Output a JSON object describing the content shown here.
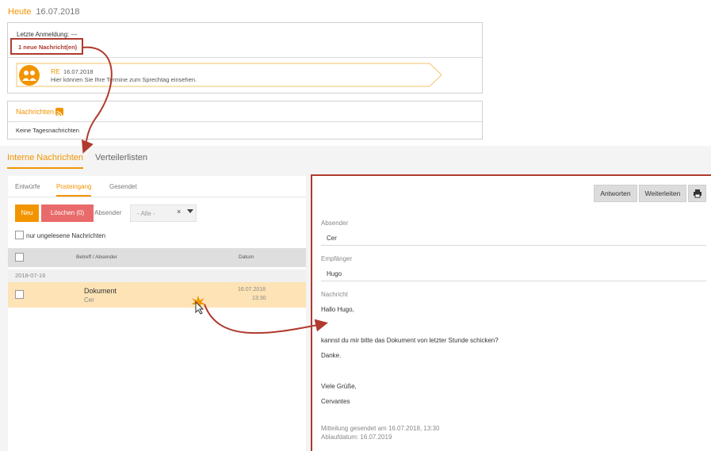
{
  "today": {
    "label": "Heute",
    "date": "16.07.2018"
  },
  "login": {
    "last_login": "Letzte Anmeldung: ---",
    "new_messages": "1 neue Nachricht(en)"
  },
  "appointment": {
    "code": "RE",
    "date": "16.07.2018",
    "text": "Hier können Sie Ihre Termine zum Sprechtag einsehen.",
    "icon": "people-icon"
  },
  "news": {
    "title": "Nachrichten",
    "icon": "rss-icon",
    "empty": "Keine Tagesnachrichten"
  },
  "main_tabs": [
    {
      "label": "Interne Nachrichten"
    },
    {
      "label": "Verteilerlisten"
    }
  ],
  "sub_tabs": [
    {
      "label": "Entwürfe"
    },
    {
      "label": "Posteingang"
    },
    {
      "label": "Gesendet"
    }
  ],
  "toolbar": {
    "new_label": "Neu",
    "delete_label": "Löschen (0)",
    "sender_label": "Absender",
    "sender_value": "- Alle -",
    "clear_glyph": "×",
    "unread_label": "nur ungelesene Nachrichten"
  },
  "table": {
    "headers": {
      "subject": "Betreff / Absender",
      "date": "Datum"
    },
    "group_date": "2018-07-16",
    "rows": [
      {
        "subject": "Dokument",
        "from": "Cer",
        "date": "16.07.2018",
        "time": "13:30"
      }
    ]
  },
  "detail": {
    "buttons": {
      "reply": "Antworten",
      "forward": "Weiterleiten",
      "print_icon": "printer-icon"
    },
    "sender_label": "Absender",
    "sender": "Cer",
    "recipient_label": "Empfänger",
    "recipient": "Hugo",
    "message_label": "Nachricht",
    "body": [
      "Hallo Hugo,",
      "kannst du mir bitte das Dokument von letzter Stunde schicken?",
      "Danke.",
      "Viele Grüße,",
      "Cervantes"
    ],
    "sent_info": "Mitteilung gesendet am 16.07.2018, 13:30",
    "expiry_info": "Ablaufdatum: 16.07.2019"
  },
  "colors": {
    "accent": "#f29400",
    "danger": "#e96a6a",
    "annotation": "#b03a2e",
    "selected_row": "#fde3b5"
  }
}
